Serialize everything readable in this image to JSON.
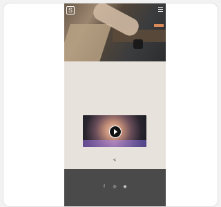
{
  "page": {
    "brand_logo_letter": "S",
    "menu_icon": "hamburger-icon",
    "body_text": "",
    "video": {
      "play_icon": "play-icon"
    },
    "share_icon": "share-icon",
    "footer": {
      "title": "",
      "social_icons": [
        "facebook-icon",
        "instagram-icon",
        "globe-icon"
      ],
      "line1": "",
      "line2": ""
    }
  },
  "colors": {
    "page_background": "#e7e3dc",
    "footer_background": "#4a4a4a",
    "video_glow": "#8a64c8"
  }
}
